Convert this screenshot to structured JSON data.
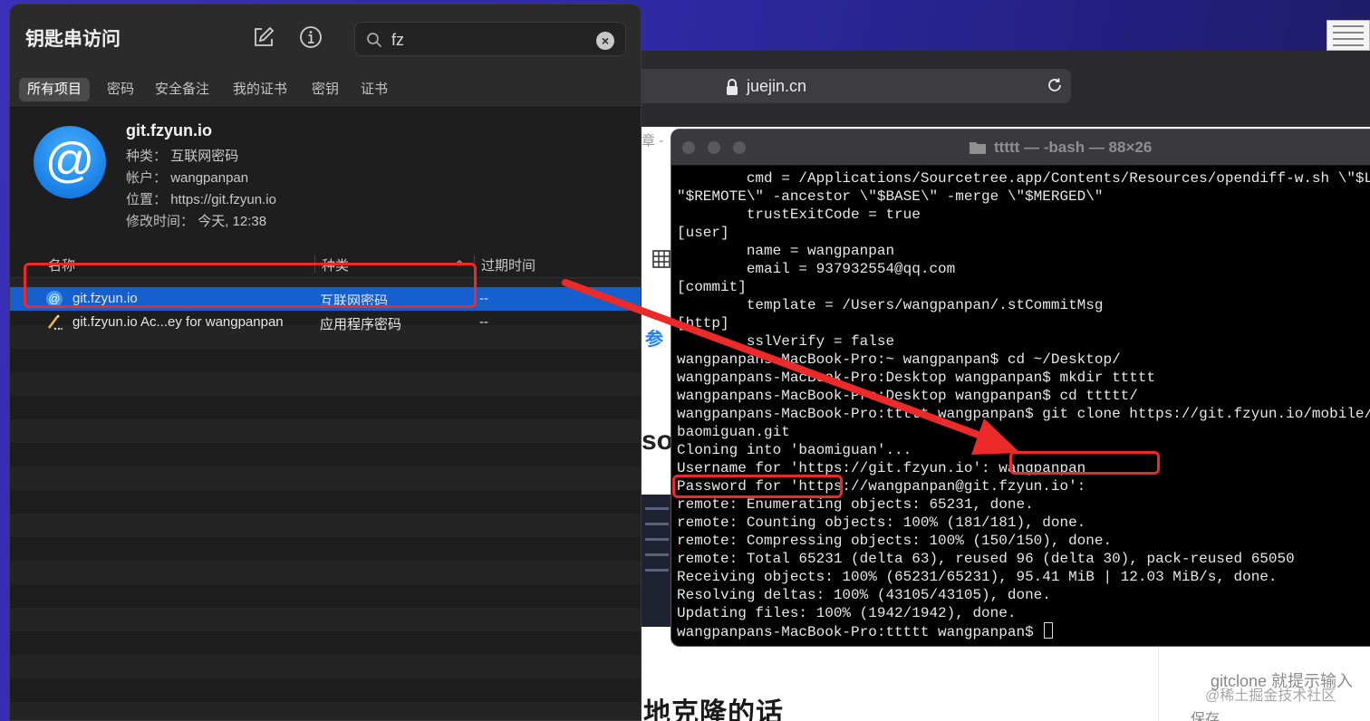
{
  "browser": {
    "url": "juejin.cn",
    "fragments": {
      "zhang": "章 -",
      "can": "参",
      "so": "so",
      "heading": "地克隆的话",
      "gitclone_hint": "gitclone 就提示输入",
      "save": "保存",
      "watermark": "@稀土掘金技术社区"
    }
  },
  "keychain": {
    "title": "钥匙串访问",
    "toolbar_icons": [
      "compose-icon",
      "info-icon"
    ],
    "search": {
      "value": "fz",
      "placeholder": ""
    },
    "tabs": [
      {
        "label": "所有项目",
        "active": true
      },
      {
        "label": "密码",
        "active": false
      },
      {
        "label": "安全备注",
        "active": false
      },
      {
        "label": "我的证书",
        "active": false
      },
      {
        "label": "密钥",
        "active": false
      },
      {
        "label": "证书",
        "active": false
      }
    ],
    "detail": {
      "name": "git.fzyun.io",
      "kind_label": "种类：",
      "kind": "互联网密码",
      "account_label": "帐户：",
      "account": "wangpanpan",
      "where_label": "位置：",
      "where": "https://git.fzyun.io",
      "modified_label": "修改时间：",
      "modified": "今天, 12:38",
      "icon_glyph": "@"
    },
    "columns": {
      "name": "名称",
      "kind": "种类",
      "expires": "过期时间"
    },
    "rows": [
      {
        "name": "git.fzyun.io",
        "kind": "互联网密码",
        "expires": "--",
        "icon": "at-icon",
        "selected": true
      },
      {
        "name": "git.fzyun.io Ac...ey for wangpanpan",
        "kind": "应用程序密码",
        "expires": "--",
        "icon": "pencil-key-icon",
        "selected": false
      }
    ]
  },
  "terminal": {
    "title": "ttttt — -bash — 88×26",
    "lines": [
      "        cmd = /Applications/Sourcetree.app/Contents/Resources/opendiff-w.sh \\\"$LOCAL\\\"",
      "\"$REMOTE\\\" -ancestor \\\"$BASE\\\" -merge \\\"$MERGED\\\"",
      "        trustExitCode = true",
      "[user]",
      "        name = wangpanpan",
      "        email = 937932554@qq.com",
      "[commit]",
      "        template = /Users/wangpanpan/.stCommitMsg",
      "[http]",
      "        sslVerify = false",
      "wangpanpans-MacBook-Pro:~ wangpanpan$ cd ~/Desktop/",
      "wangpanpans-MacBook-Pro:Desktop wangpanpan$ mkdir ttttt",
      "wangpanpans-MacBook-Pro:Desktop wangpanpan$ cd ttttt/",
      "wangpanpans-MacBook-Pro:ttttt wangpanpan$ git clone https://git.fzyun.io/mobile/",
      "baomiguan.git",
      "Cloning into 'baomiguan'...",
      "Username for 'https://git.fzyun.io': wangpanpan",
      "Password for 'https://wangpanpan@git.fzyun.io':",
      "remote: Enumerating objects: 65231, done.",
      "remote: Counting objects: 100% (181/181), done.",
      "remote: Compressing objects: 100% (150/150), done.",
      "remote: Total 65231 (delta 63), reused 96 (delta 30), pack-reused 65050",
      "Receiving objects: 100% (65231/65231), 95.41 MiB | 12.03 MiB/s, done.",
      "Resolving deltas: 100% (43105/43105), done.",
      "Updating files: 100% (1942/1942), done."
    ],
    "prompt": "wangpanpans-MacBook-Pro:ttttt wangpanpan$ "
  },
  "colors": {
    "accent": "#1560cd",
    "annotation": "#ec2a2a"
  }
}
